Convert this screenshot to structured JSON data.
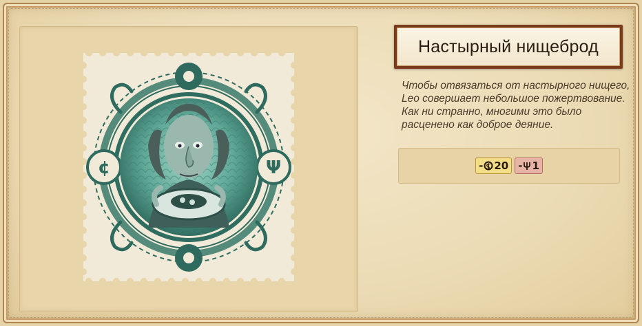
{
  "event": {
    "title": "Настырный нищеброд",
    "description_lines": [
      "Чтобы отвязаться от настырного нищего,",
      "Leo совершает небольшое пожертвование.",
      "Как ни странно, многими это было",
      "расценено как доброе деяние."
    ]
  },
  "effects": [
    {
      "icon": "gold-coin-icon",
      "sign": "-",
      "value": "20",
      "color": "#f3dd86"
    },
    {
      "icon": "trident-faith-icon",
      "sign": "-",
      "value": "1",
      "color": "#e9b4a8"
    }
  ],
  "colors": {
    "title_border": "#7a3a1c",
    "stamp_ink": "#2e6b5e",
    "parchment": "#ecdcb6"
  }
}
